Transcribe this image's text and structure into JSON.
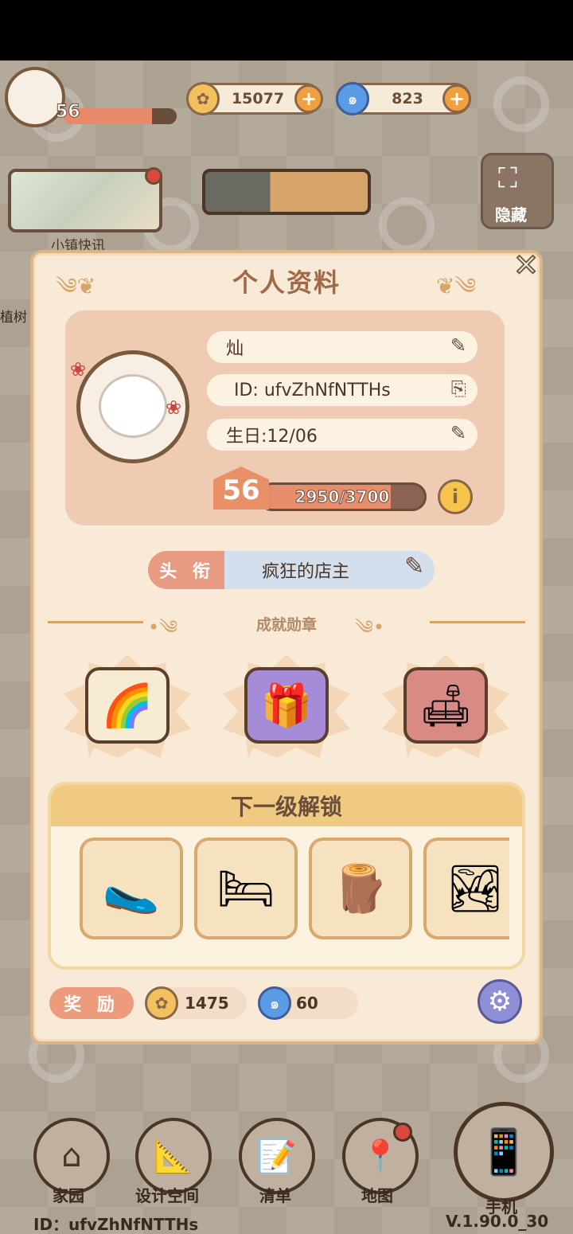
{
  "top_bar": {
    "player_level": "56",
    "level_progress": 0.78,
    "coins": "15077",
    "gems": "823"
  },
  "hud": {
    "news_label": "小镇快讯",
    "hide_label": "隐藏",
    "side_label": "植树"
  },
  "profile": {
    "title": "个人资料",
    "name": "灿",
    "id_text": "ID: ufvZhNfNTTHs",
    "birthday_text": "生日:12/06",
    "level": "56",
    "xp_text": "2950/3700",
    "xp_current": 2950,
    "xp_max": 3700,
    "honor_tag": "头 衔",
    "honor_value": "疯狂的店主"
  },
  "achievements": {
    "label": "成就勋章",
    "items": [
      {
        "name": "rainbow-star-scroll",
        "icon": "🌈"
      },
      {
        "name": "gift-box",
        "icon": "🎁"
      },
      {
        "name": "armchair",
        "icon": "🛋"
      }
    ]
  },
  "next_unlock": {
    "title": "下一级解锁",
    "items": [
      {
        "name": "slippers",
        "icon": "🥿"
      },
      {
        "name": "bed",
        "icon": "🛏"
      },
      {
        "name": "wooden-stool",
        "icon": "🪵"
      },
      {
        "name": "rug",
        "icon": "🏞"
      }
    ]
  },
  "reward": {
    "label": "奖 励",
    "coins": "1475",
    "gems": "60"
  },
  "nav": {
    "home": "家园",
    "design": "设计空间",
    "list": "清单",
    "map": "地图",
    "phone": "手机"
  },
  "footer": {
    "id_text": "ID：ufvZhNfNTTHs",
    "version": "V.1.90.0_30"
  },
  "colors": {
    "panel_bg": "#f8ead6",
    "accent": "#e89068",
    "title_text": "#a06a48"
  }
}
